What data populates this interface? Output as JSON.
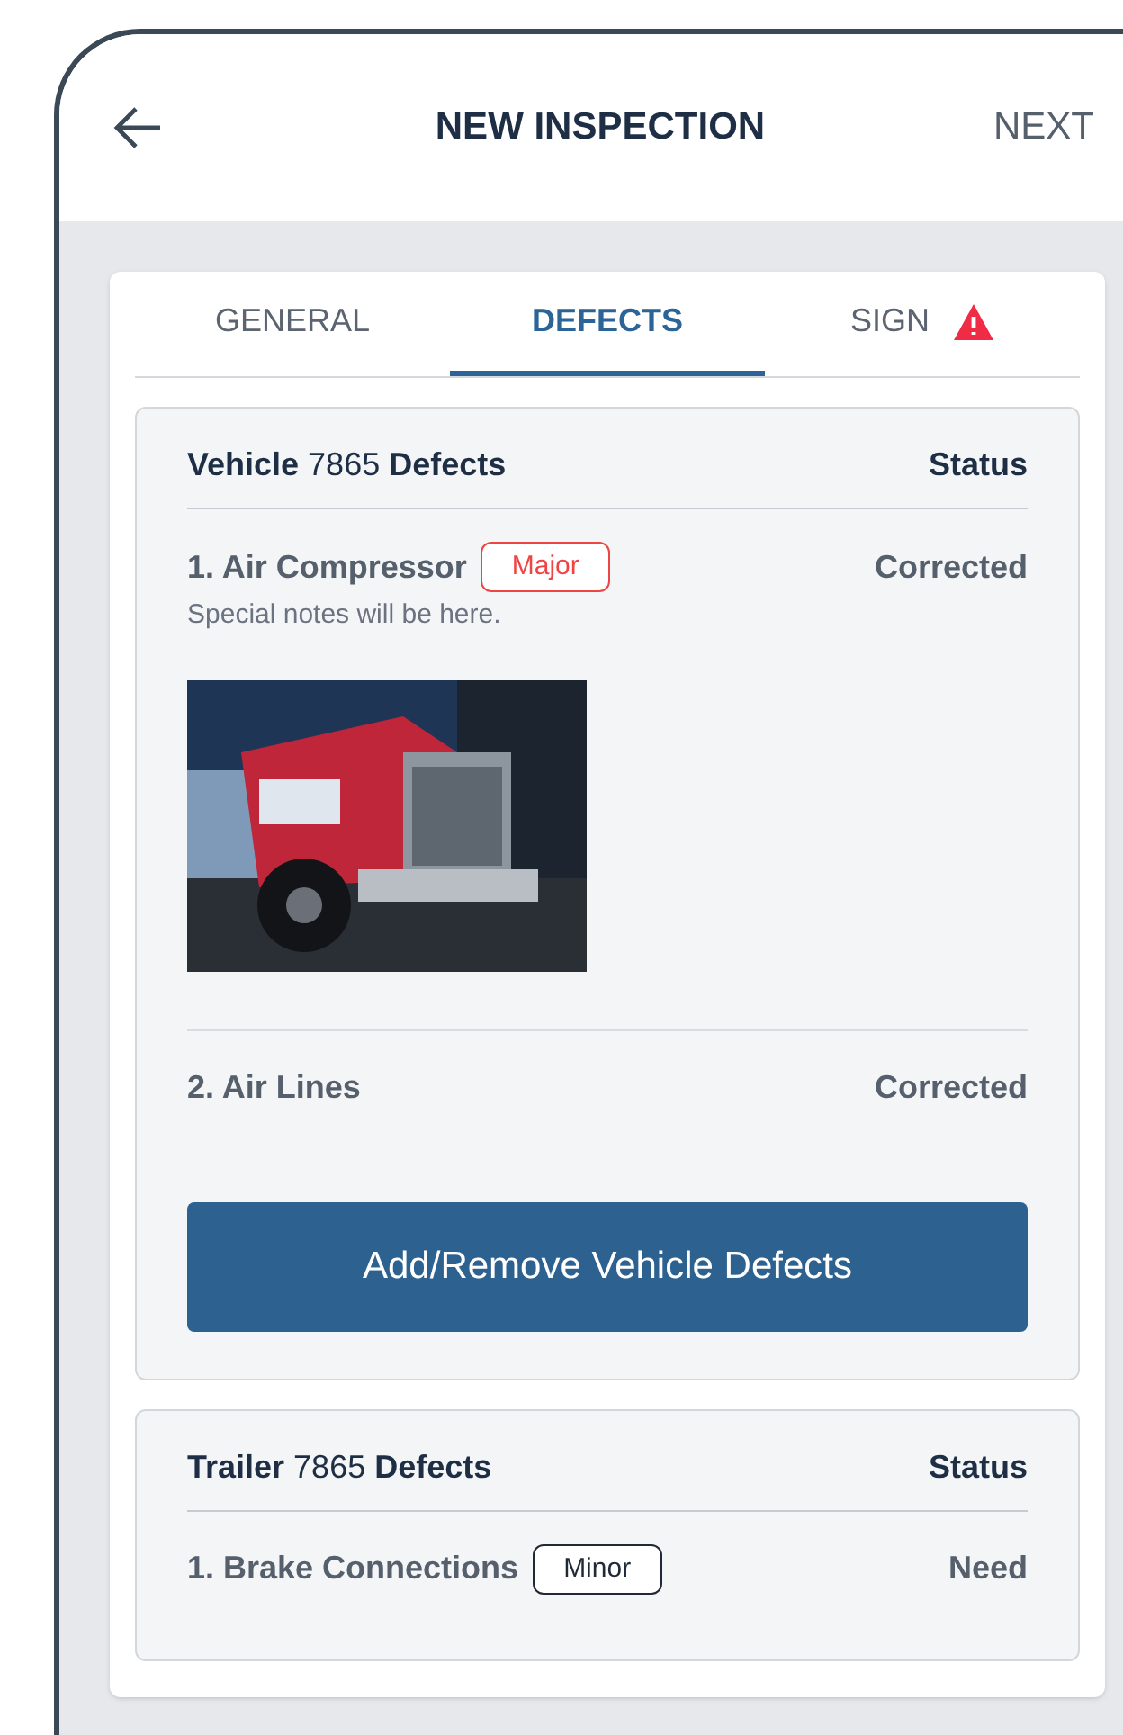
{
  "header": {
    "title": "NEW INSPECTION",
    "next": "NEXT"
  },
  "tabs": [
    {
      "label": "GENERAL",
      "selected": false,
      "warning": false
    },
    {
      "label": "DEFECTS",
      "selected": true,
      "warning": false
    },
    {
      "label": "SIGN",
      "selected": false,
      "warning": true
    }
  ],
  "sections": [
    {
      "title": "**Vehicle** 7865 **Defects**",
      "status_header": "Status",
      "defects": [
        {
          "name": "1. Air Compressor",
          "severity": "Major",
          "color": "#ef4444",
          "note": "Special notes will be here.",
          "status": "Corrected"
        },
        {
          "name": "2. Air Lines",
          "status": "Corrected"
        }
      ],
      "button": "Add/Remove Vehicle Defects"
    },
    {
      "title": "**Trailer** 7865 **Defects**",
      "status_header": "Status",
      "defects": [
        {
          "name": "1. Brake Connections",
          "severity": "Minor",
          "color": "#1f2937",
          "status": "Need"
        }
      ]
    }
  ]
}
